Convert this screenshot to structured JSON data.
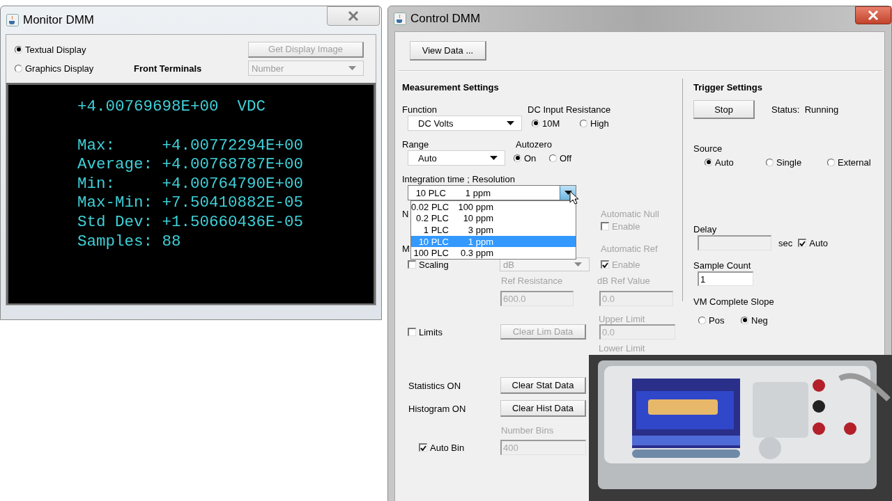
{
  "monitor_window": {
    "title": "Monitor DMM",
    "display_modes": [
      {
        "label": "Textual Display",
        "selected": true
      },
      {
        "label": "Graphics Display",
        "selected": false
      }
    ],
    "terminals_label": "Front Terminals",
    "get_image_button": {
      "label": "Get Display Image",
      "disabled": true
    },
    "format_select": {
      "value": "Number",
      "disabled": true
    },
    "display": {
      "reading": "+4.00769698E+00  VDC",
      "lines": [
        "Max:     +4.00772294E+00",
        "Average: +4.00768787E+00",
        "Min:     +4.00764790E+00",
        "Max-Min: +7.50410882E-05",
        "Std Dev: +1.50660436E-05",
        "Samples: 88"
      ]
    }
  },
  "control_window": {
    "title": "Control DMM",
    "view_data_button": "View Data ...",
    "measurement": {
      "title": "Measurement Settings",
      "function": {
        "label": "Function",
        "value": "DC Volts"
      },
      "input_resistance": {
        "label": "DC Input Resistance",
        "options": [
          {
            "label": "10M",
            "selected": true
          },
          {
            "label": "High",
            "selected": false
          }
        ]
      },
      "range": {
        "label": "Range",
        "value": "Auto"
      },
      "autozero": {
        "label": "Autozero",
        "options": [
          {
            "label": "On",
            "selected": true
          },
          {
            "label": "Off",
            "selected": false
          }
        ]
      },
      "integration": {
        "label": "Integration time ; Resolution",
        "value": {
          "plc": "10 PLC",
          "resolution": "1 ppm"
        },
        "expanded": true,
        "options": [
          {
            "plc": "0.02 PLC",
            "resolution": "100 ppm",
            "selected": false
          },
          {
            "plc": "0.2 PLC",
            "resolution": "10 ppm",
            "selected": false
          },
          {
            "plc": "1 PLC",
            "resolution": "3 ppm",
            "selected": false
          },
          {
            "plc": "10 PLC",
            "resolution": "1 ppm",
            "selected": true
          },
          {
            "plc": "100 PLC",
            "resolution": "0.3 ppm",
            "selected": false
          }
        ]
      },
      "null_heading": "N",
      "math_heading": "M",
      "automatic_null": {
        "label": "Automatic Null",
        "check_label": "Enable",
        "checked": false,
        "disabled": true
      },
      "automatic_ref": {
        "label": "Automatic Ref",
        "check_label": "Enable",
        "checked": true,
        "disabled": true
      },
      "scaling": {
        "label": "Scaling",
        "checked": false,
        "select_value": "dB",
        "select_disabled": true
      },
      "ref_resistance": {
        "label": "Ref Resistance",
        "value": "600.0",
        "disabled": true
      },
      "db_ref": {
        "label": "dB Ref Value",
        "value": "0.0",
        "disabled": true
      },
      "limits": {
        "label": "Limits",
        "checked": false,
        "clear_button": {
          "label": "Clear Lim Data",
          "disabled": true
        },
        "upper": {
          "label": "Upper Limit",
          "value": "0.0",
          "disabled": true
        },
        "lower_label": "Lower Limit"
      },
      "statistics": {
        "label": "Statistics ON",
        "clear_button": {
          "label": "Clear Stat Data",
          "disabled": false
        }
      },
      "histogram": {
        "label": "Histogram ON",
        "clear_button": {
          "label": "Clear Hist Data",
          "disabled": false
        },
        "bins_label": "Number Bins",
        "auto_bin": {
          "label": "Auto Bin",
          "checked": true
        },
        "bins_value": "400",
        "bins_disabled": true
      }
    },
    "trigger": {
      "title": "Trigger Settings",
      "stop_button": "Stop",
      "status": "Status:  Running",
      "source": {
        "label": "Source",
        "options": [
          {
            "label": "Auto",
            "selected": true
          },
          {
            "label": "Single",
            "selected": false
          },
          {
            "label": "External",
            "selected": false
          }
        ]
      },
      "delay": {
        "label": "Delay",
        "unit": "sec",
        "disabled": true,
        "auto": {
          "label": "Auto",
          "checked": true
        }
      },
      "sample_count": {
        "label": "Sample Count",
        "value": "1"
      },
      "slope": {
        "label": "VM Complete Slope",
        "options": [
          {
            "label": "Pos",
            "selected": false
          },
          {
            "label": "Neg",
            "selected": true
          }
        ]
      }
    }
  }
}
